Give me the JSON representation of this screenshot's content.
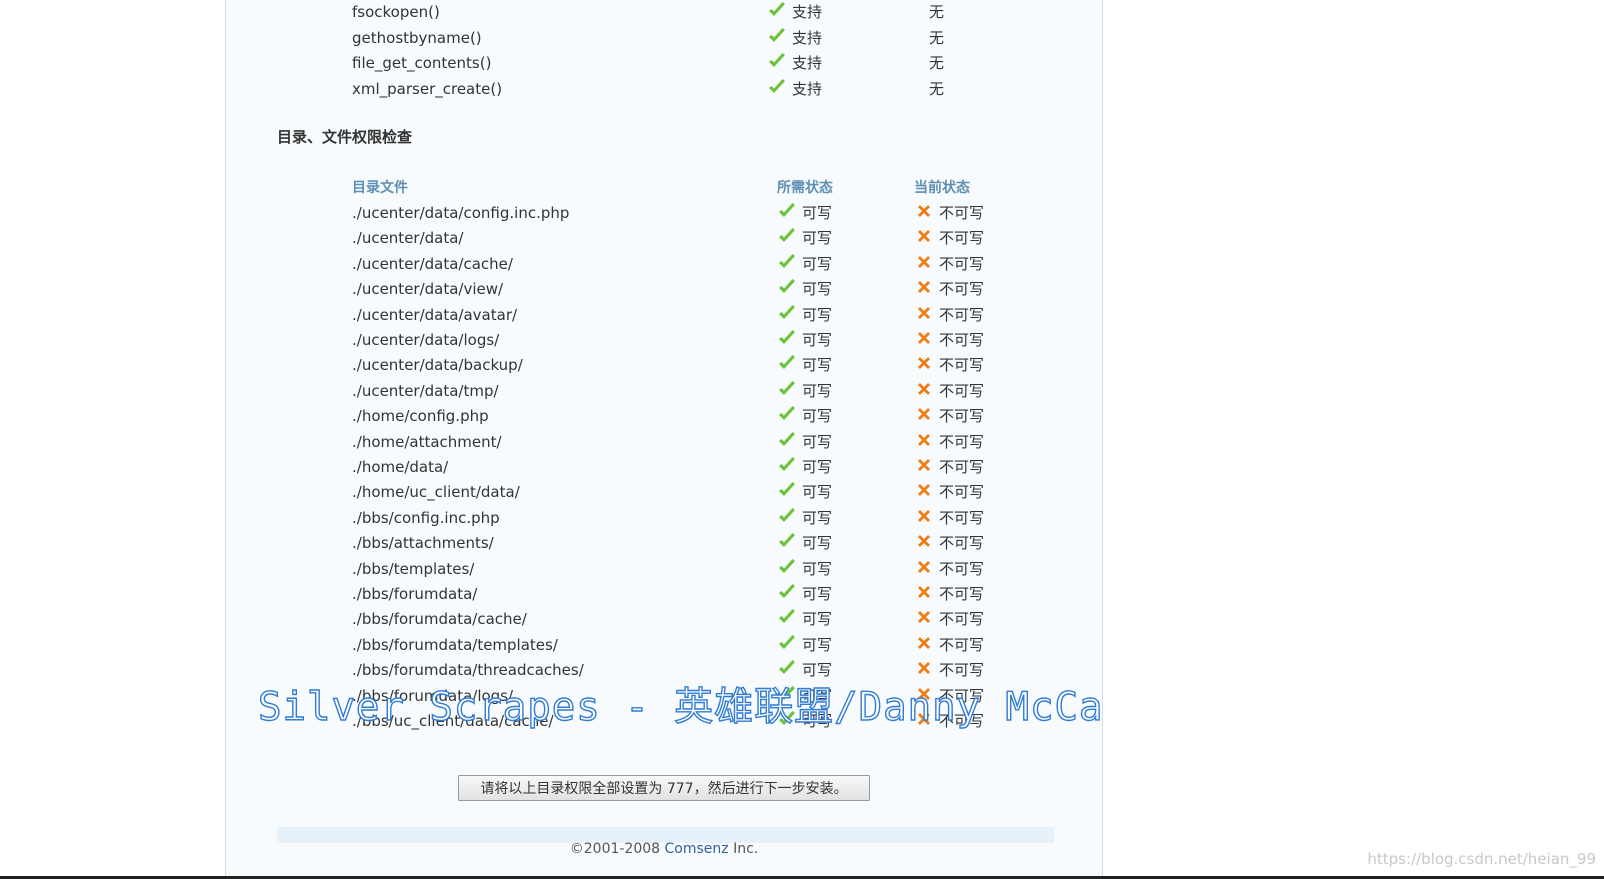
{
  "functions": [
    {
      "name": "fsockopen()",
      "required": "支持",
      "current": "无"
    },
    {
      "name": "gethostbyname()",
      "required": "支持",
      "current": "无"
    },
    {
      "name": "file_get_contents()",
      "required": "支持",
      "current": "无"
    },
    {
      "name": "xml_parser_create()",
      "required": "支持",
      "current": "无"
    }
  ],
  "dir_check": {
    "title": "目录、文件权限检查",
    "headers": {
      "file": "目录文件",
      "required": "所需状态",
      "current": "当前状态"
    },
    "rows": [
      {
        "path": "./ucenter/data/config.inc.php",
        "required": "可写",
        "current": "不可写"
      },
      {
        "path": "./ucenter/data/",
        "required": "可写",
        "current": "不可写"
      },
      {
        "path": "./ucenter/data/cache/",
        "required": "可写",
        "current": "不可写"
      },
      {
        "path": "./ucenter/data/view/",
        "required": "可写",
        "current": "不可写"
      },
      {
        "path": "./ucenter/data/avatar/",
        "required": "可写",
        "current": "不可写"
      },
      {
        "path": "./ucenter/data/logs/",
        "required": "可写",
        "current": "不可写"
      },
      {
        "path": "./ucenter/data/backup/",
        "required": "可写",
        "current": "不可写"
      },
      {
        "path": "./ucenter/data/tmp/",
        "required": "可写",
        "current": "不可写"
      },
      {
        "path": "./home/config.php",
        "required": "可写",
        "current": "不可写"
      },
      {
        "path": "./home/attachment/",
        "required": "可写",
        "current": "不可写"
      },
      {
        "path": "./home/data/",
        "required": "可写",
        "current": "不可写"
      },
      {
        "path": "./home/uc_client/data/",
        "required": "可写",
        "current": "不可写"
      },
      {
        "path": "./bbs/config.inc.php",
        "required": "可写",
        "current": "不可写"
      },
      {
        "path": "./bbs/attachments/",
        "required": "可写",
        "current": "不可写"
      },
      {
        "path": "./bbs/templates/",
        "required": "可写",
        "current": "不可写"
      },
      {
        "path": "./bbs/forumdata/",
        "required": "可写",
        "current": "不可写"
      },
      {
        "path": "./bbs/forumdata/cache/",
        "required": "可写",
        "current": "不可写"
      },
      {
        "path": "./bbs/forumdata/templates/",
        "required": "可写",
        "current": "不可写"
      },
      {
        "path": "./bbs/forumdata/threadcaches/",
        "required": "可写",
        "current": "不可写"
      },
      {
        "path": "./bbs/forumdata/logs/",
        "required": "可写",
        "current": "不可写"
      },
      {
        "path": "./bbs/uc_client/data/cache/",
        "required": "可写",
        "current": "不可写"
      }
    ]
  },
  "button": {
    "label": "请将以上目录权限全部设置为 777，然后进行下一步安装。"
  },
  "footer": {
    "copyright": "©2001-2008 ",
    "company": "Comsenz",
    "suffix": " Inc."
  },
  "watermark": {
    "overlay_text": "Silver Scrapes - 英雄联盟/Danny McCa",
    "site_text": "https://blog.csdn.net/heian_99"
  },
  "colors": {
    "check": "#6cc33a",
    "cross": "#f07c14",
    "header": "#5d8fb3",
    "link": "#2f63a4"
  },
  "icons": {
    "ok": "check-icon",
    "fail": "cross-icon"
  }
}
